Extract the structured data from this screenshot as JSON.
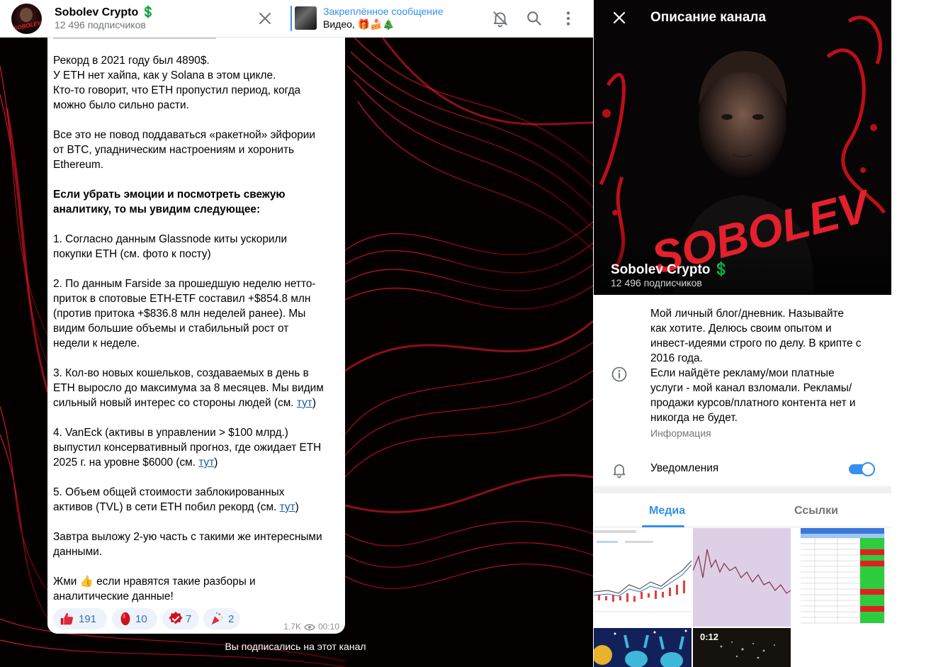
{
  "chat": {
    "title": "Sobolev Crypto",
    "title_emoji": "💲",
    "subscribers": "12 496 подписчиков",
    "avatar_label": "SOBOLEV",
    "pinned": {
      "title": "Закреплённое сообщение",
      "text": "Видео, 🎁🍰🎄"
    }
  },
  "message": {
    "lines": [
      {
        "text": "Рекорд в 2021 году был 4890$."
      },
      {
        "text": "У ETH нет хайпа, как у Solana в этом цикле."
      },
      {
        "text": "Кто-то говорит, что ETH пропустил период, когда"
      },
      {
        "text": "можно было сильно расти."
      },
      {
        "text": ""
      },
      {
        "text": "Все это не повод поддаваться «ракетной» эйфории"
      },
      {
        "text": "от BTC, упадническим настроениям и хоронить"
      },
      {
        "text": "Ethereum."
      },
      {
        "text": ""
      },
      {
        "text": "Если убрать эмоции и посмотреть свежую",
        "bold": true
      },
      {
        "text": "аналитику, то мы увидим следующее:",
        "bold": true
      },
      {
        "text": ""
      },
      {
        "text": "1. Согласно данным Glassnode киты ускорили"
      },
      {
        "text": "покупки ETH (см. фото к посту)"
      },
      {
        "text": ""
      },
      {
        "text": "2. По данным Farside за прошедшую неделю нетто-"
      },
      {
        "text": "приток в спотовые ETH-ETF составил +$854.8 млн"
      },
      {
        "text": "(против притока +$836.8 млн неделей ранее). Мы"
      },
      {
        "text": "видим большие объемы и стабильный рост от"
      },
      {
        "text": "недели к неделе."
      },
      {
        "text": ""
      },
      {
        "text": "3. Кол-во новых кошельков, создаваемых в день в"
      },
      {
        "text": "ETH выросло до максимума за 8 месяцев. Мы видим"
      },
      {
        "text": "сильный новый интерес со стороны людей (см. ",
        "link": "тут",
        "after": ")"
      },
      {
        "text": ""
      },
      {
        "text": "4. VanEck (активы в управлении > $100 млрд.)"
      },
      {
        "text": "выпустил консервативный прогноз, где ожидает ETH"
      },
      {
        "text": "2025 г. на уровне $6000 (см. ",
        "link": "тут",
        "after": ")"
      },
      {
        "text": ""
      },
      {
        "text": "5. Объем общей стоимости заблокированных"
      },
      {
        "text": "активов (TVL) в сети ETH побил рекорд (см. ",
        "link": "тут",
        "after": ")"
      },
      {
        "text": ""
      },
      {
        "text": "Завтра выложу 2-ую часть с такими же интересными"
      },
      {
        "text": "данными."
      },
      {
        "text": ""
      },
      {
        "text": "Жми 👍 если нравятся такие разборы и"
      },
      {
        "text": "аналитические данные!"
      }
    ],
    "reactions": [
      {
        "emoji": "thumbs-up",
        "count": "191"
      },
      {
        "emoji": "red-ruby",
        "count": "10"
      },
      {
        "emoji": "red-badge-check",
        "count": "7"
      },
      {
        "emoji": "party-popper",
        "count": "2"
      }
    ],
    "views": "1.7K",
    "time": "00:10"
  },
  "subscribed_note": "Вы подписались на этот канал",
  "panel": {
    "title": "Описание канала",
    "hero_word": "SOBOLEV",
    "channel_name": "Sobolev Crypto",
    "channel_emoji": "💲",
    "subscribers": "12 496 подписчиков",
    "description": [
      "Мой личный блог/дневник. Называйте",
      "как хотите. Делюсь своим опытом и",
      "инвест-идеями строго по делу. В крипте с",
      "2016 года.",
      "Если найдёте рекламу/мои платные",
      "услуги - мой канал взломали. Рекламы/",
      "продажи курсов/платного контента нет и",
      "никогда не будет."
    ],
    "description_label": "Информация",
    "notifications_label": "Уведомления",
    "notifications_on": true,
    "tabs": {
      "media": "Медиа",
      "links": "Ссылки"
    },
    "video_duration": "0:12"
  },
  "colors": {
    "accent": "#3390ec",
    "dollar": "#d1213a",
    "brand_red": "#e3202c"
  }
}
